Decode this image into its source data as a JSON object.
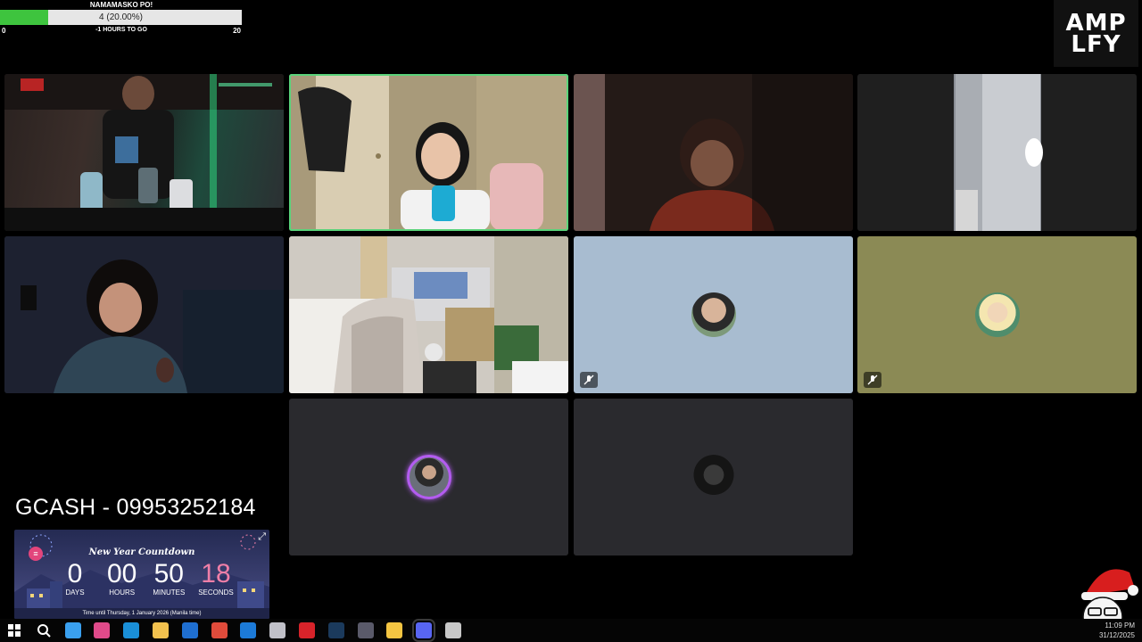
{
  "goal": {
    "title": "NAMAMASKO PO!",
    "progress_text": "4 (20.00%)",
    "progress_fraction": 0.2,
    "min": "0",
    "max": "20",
    "subtitle": "-1 HOURS TO GO",
    "fill_color": "#3ec43e"
  },
  "logo": {
    "line1": "AMP",
    "line2": "LFY"
  },
  "window_controls": {
    "minimize": "–",
    "maximize": "☐",
    "close": "✕"
  },
  "tiles": [
    {
      "name": "video-tile-1",
      "kind": "camera"
    },
    {
      "name": "video-tile-2",
      "kind": "camera",
      "active": true
    },
    {
      "name": "video-tile-3",
      "kind": "camera"
    },
    {
      "name": "video-tile-4",
      "kind": "camera"
    },
    {
      "name": "video-tile-5",
      "kind": "camera"
    },
    {
      "name": "video-tile-6",
      "kind": "camera"
    },
    {
      "name": "avatar-tile-1",
      "kind": "avatar",
      "muted": true,
      "bg": "#a8bcd0"
    },
    {
      "name": "avatar-tile-2",
      "kind": "avatar",
      "muted": true,
      "bg": "#8b8a55"
    },
    {
      "name": "avatar-tile-3",
      "kind": "avatar",
      "bg": "#2a2a2e"
    },
    {
      "name": "avatar-tile-4",
      "kind": "avatar",
      "bg": "#2a2a2e"
    }
  ],
  "gcash": {
    "text": "GCASH - 09953252184"
  },
  "countdown": {
    "title": "New Year Countdown",
    "days": "0",
    "hours": "00",
    "minutes": "50",
    "seconds": "18",
    "days_label": "DAYS",
    "hours_label": "HOURS",
    "minutes_label": "MINUTES",
    "seconds_label": "SECONDS",
    "footer": "Time until Thursday, 1 January 2026 (Manila time)"
  },
  "taskbar": {
    "time": "11:09 PM",
    "date": "31/12/2025",
    "icons": [
      "windows-start-icon",
      "search-icon",
      "copilot-icon",
      "m365-icon",
      "edge-icon",
      "file-explorer-icon",
      "outlook-icon",
      "chrome-icon",
      "store-icon",
      "app-icon",
      "vmix-icon",
      "steam-icon",
      "app-icon-2",
      "notes-icon",
      "discord-icon",
      "obs-icon"
    ]
  }
}
